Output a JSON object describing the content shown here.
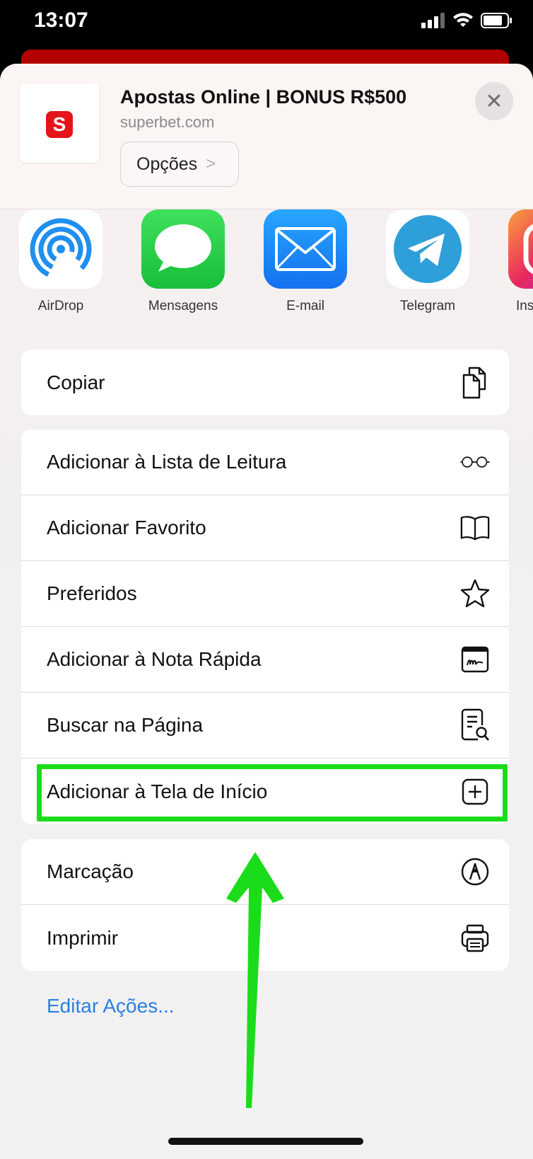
{
  "status_bar": {
    "time": "13:07"
  },
  "header": {
    "site_logo_letter": "S",
    "title": "Apostas Online | BONUS R$500",
    "url": "superbet.com",
    "options_label": "Opções",
    "options_chevron": ">",
    "close_glyph": "✕"
  },
  "apps": [
    {
      "label": "AirDrop",
      "icon": "airdrop-icon"
    },
    {
      "label": "Mensagens",
      "icon": "messages-icon"
    },
    {
      "label": "E-mail",
      "icon": "mail-icon"
    },
    {
      "label": "Telegram",
      "icon": "telegram-icon"
    },
    {
      "label": "Ins",
      "icon": "instagram-icon"
    }
  ],
  "actions": {
    "copy": {
      "label": "Copiar",
      "icon": "copy-icon"
    },
    "group2": [
      {
        "label": "Adicionar à Lista de Leitura",
        "icon": "glasses-icon"
      },
      {
        "label": "Adicionar Favorito",
        "icon": "book-icon"
      },
      {
        "label": "Preferidos",
        "icon": "star-icon"
      },
      {
        "label": "Adicionar à Nota Rápida",
        "icon": "quick-note-icon"
      },
      {
        "label": "Buscar na Página",
        "icon": "find-in-page-icon"
      },
      {
        "label": "Adicionar à Tela de Início",
        "icon": "add-square-icon"
      }
    ],
    "group3": [
      {
        "label": "Marcação",
        "icon": "markup-icon"
      },
      {
        "label": "Imprimir",
        "icon": "printer-icon"
      }
    ],
    "edit_label": "Editar Ações..."
  },
  "colors": {
    "highlight": "#1bdc1b",
    "link_blue": "#2b7fe0",
    "brand_red": "#e4141b"
  }
}
